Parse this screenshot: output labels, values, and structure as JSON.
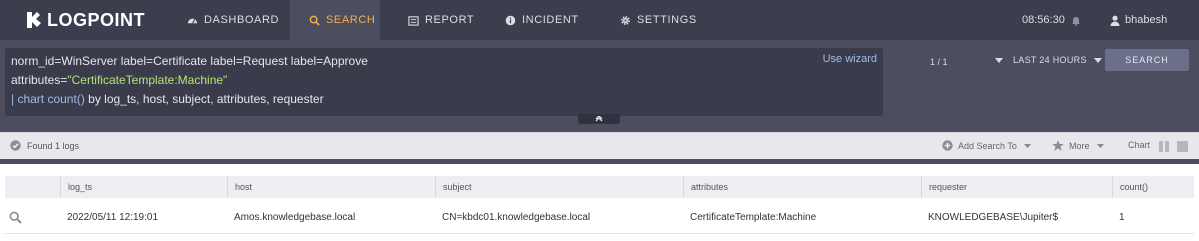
{
  "app": {
    "logo_text": "LOGPOINT"
  },
  "nav": {
    "tabs": [
      {
        "label": "DASHBOARD",
        "icon": "dashboard-icon"
      },
      {
        "label": "SEARCH",
        "icon": "search-icon",
        "active": true
      },
      {
        "label": "REPORT",
        "icon": "report-icon"
      },
      {
        "label": "INCIDENT",
        "icon": "incident-icon"
      },
      {
        "label": "SETTINGS",
        "icon": "gear-icon"
      }
    ],
    "time": "08:56:30",
    "notification_icon": "bell-icon",
    "user": "bhabesh",
    "user_icon": "user-icon"
  },
  "query": {
    "line1": "norm_id=WinServer label=Certificate label=Request label=Approve",
    "line2_key": "attributes=",
    "line2_value": "\"CertificateTemplate:Machine\"",
    "line3_pipe": "| chart count()",
    "line3_rest": " by log_ts, host, subject, attributes, requester",
    "wizard_label": "Use wizard"
  },
  "pager": "1 / 1",
  "time_range": "LAST 24 HOURS",
  "search_button": "SEARCH",
  "status": {
    "found": "Found 1 logs",
    "add_search_to": "Add Search To",
    "more": "More",
    "chart": "Chart"
  },
  "table": {
    "columns": [
      "log_ts",
      "host",
      "subject",
      "attributes",
      "requester",
      "count()"
    ],
    "rows": [
      [
        "2022/05/11 12:19:01",
        "Amos.knowledgebase.local",
        "CN=kbdc01.knowledgebase.local",
        "CertificateTemplate:Machine",
        "KNOWLEDGEBASE\\Jupiter$",
        "1"
      ]
    ]
  },
  "colors": {
    "nav_bg": "#3c3e4e",
    "active_tab": "#f0b14c",
    "query_string": "#b5e27a",
    "query_pipe": "#9fb9e9"
  }
}
